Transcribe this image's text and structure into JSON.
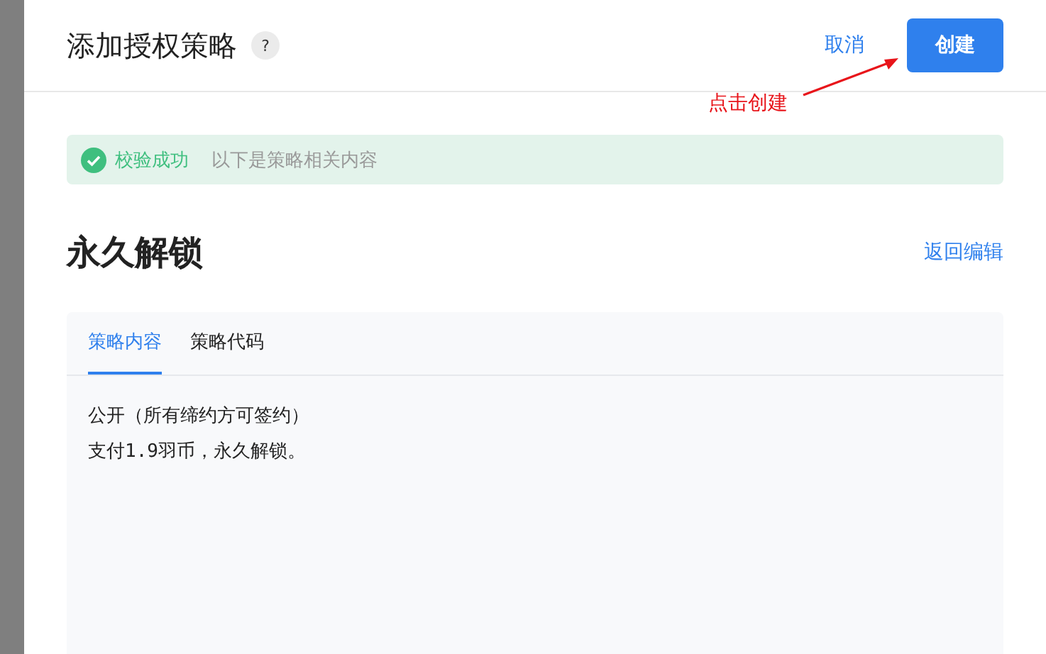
{
  "dialog": {
    "title": "添加授权策略",
    "help": "?",
    "cancel": "取消",
    "create": "创建"
  },
  "annotation": {
    "text": "点击创建"
  },
  "alert": {
    "status": "校验成功",
    "message": "以下是策略相关内容"
  },
  "policy": {
    "name": "永久解锁",
    "back": "返回编辑"
  },
  "tabs": [
    {
      "label": "策略内容",
      "selected": true
    },
    {
      "label": "策略代码",
      "selected": false
    }
  ],
  "content": [
    "公开（所有缔约方可签约）",
    "支付1.9羽币，永久解锁。"
  ]
}
